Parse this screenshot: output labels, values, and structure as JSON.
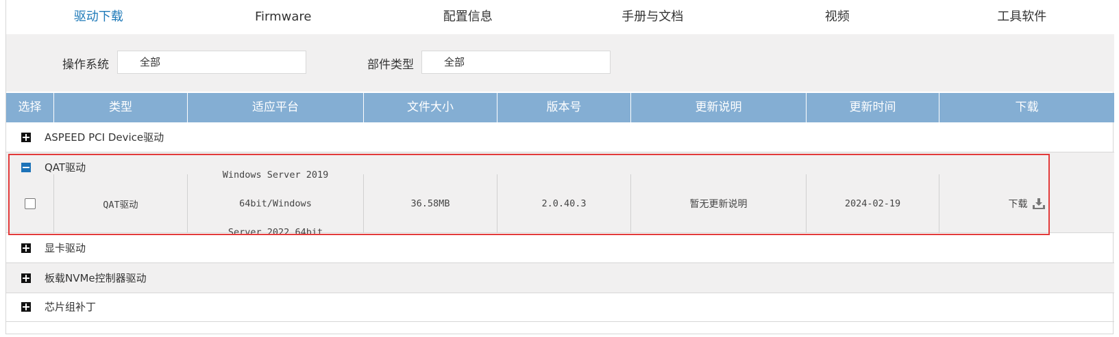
{
  "tabs": [
    {
      "label": "驱动下载",
      "active": true
    },
    {
      "label": "Firmware",
      "active": false
    },
    {
      "label": "配置信息",
      "active": false
    },
    {
      "label": "手册与文档",
      "active": false
    },
    {
      "label": "视频",
      "active": false
    },
    {
      "label": "工具软件",
      "active": false
    }
  ],
  "filters": {
    "os_label": "操作系统",
    "os_value": "全部",
    "component_label": "部件类型",
    "component_value": "全部"
  },
  "table": {
    "headers": [
      "选择",
      "类型",
      "适应平台",
      "文件大小",
      "版本号",
      "更新说明",
      "更新时间",
      "下载"
    ],
    "groups": [
      {
        "name": "ASPEED PCI Device驱动",
        "expanded": false
      },
      {
        "name": "QAT驱动",
        "expanded": true
      },
      {
        "name": "显卡驱动",
        "expanded": false
      },
      {
        "name": "板载NVMe控制器驱动",
        "expanded": false
      },
      {
        "name": "芯片组补丁",
        "expanded": false
      }
    ],
    "row": {
      "type": "QAT驱动",
      "platform_line1": "Windows Server 2019 64bit/Windows",
      "platform_line2": "Server 2022 64bit",
      "size": "36.58MB",
      "version": "2.0.40.3",
      "notes": "暂无更新说明",
      "date": "2024-02-19",
      "download_label": "下载",
      "download_icon": "download-icon"
    }
  },
  "colors": {
    "accent": "#1d79b8",
    "header_bg": "#84aed3",
    "highlight": "#e23a3a"
  }
}
